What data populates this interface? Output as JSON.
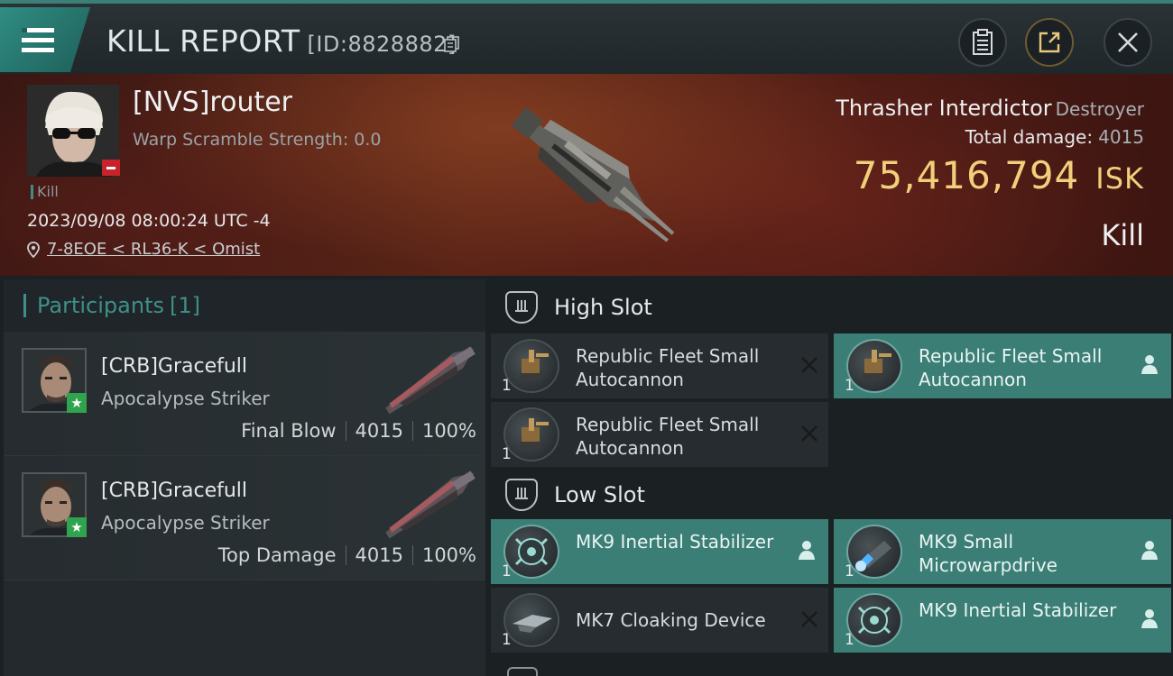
{
  "header": {
    "title": "KILL REPORT",
    "id_label": "[ID:8828882]"
  },
  "victim": {
    "name": "[NVS]router",
    "warp_scramble": "Warp Scramble Strength: 0.0",
    "kill_tag": "Kill",
    "datetime": "2023/09/08 08:00:24 UTC -4",
    "location": "7-8EOE < RL36-K < Omist",
    "ship_name": "Thrasher Interdictor",
    "ship_class": "Destroyer",
    "total_damage_label": "Total damage:",
    "total_damage_value": "4015",
    "isk_value": "75,416,794",
    "isk_unit": "ISK",
    "kill_type": "Kill"
  },
  "participants": {
    "label": "Participants",
    "count": "[1]",
    "rows": [
      {
        "name": "[CRB]Gracefull",
        "ship": "Apocalypse Striker",
        "role": "Final Blow",
        "damage": "4015",
        "percent": "100%"
      },
      {
        "name": "[CRB]Gracefull",
        "ship": "Apocalypse Striker",
        "role": "Top Damage",
        "damage": "4015",
        "percent": "100%"
      }
    ]
  },
  "slots": {
    "high": {
      "label": "High Slot",
      "items": [
        {
          "name": "Republic Fleet Small Autocannon",
          "qty": "1",
          "status": "destroyed"
        },
        {
          "name": "Republic Fleet Small Autocannon",
          "qty": "1",
          "status": "dropped"
        },
        {
          "name": "Republic Fleet Small Autocannon",
          "qty": "1",
          "status": "destroyed"
        }
      ]
    },
    "low": {
      "label": "Low Slot",
      "items": [
        {
          "name": "MK9 Inertial Stabilizer",
          "qty": "1",
          "status": "dropped"
        },
        {
          "name": "MK9 Small Microwarpdrive",
          "qty": "1",
          "status": "dropped"
        },
        {
          "name": "MK7 Cloaking Device",
          "qty": "1",
          "status": "destroyed"
        },
        {
          "name": "MK9 Inertial Stabilizer",
          "qty": "1",
          "status": "dropped"
        }
      ]
    }
  },
  "colors": {
    "accent": "#3b7e76",
    "isk": "#f2cf7a",
    "danger": "#c6232b",
    "star_badge": "#2fa34e"
  }
}
